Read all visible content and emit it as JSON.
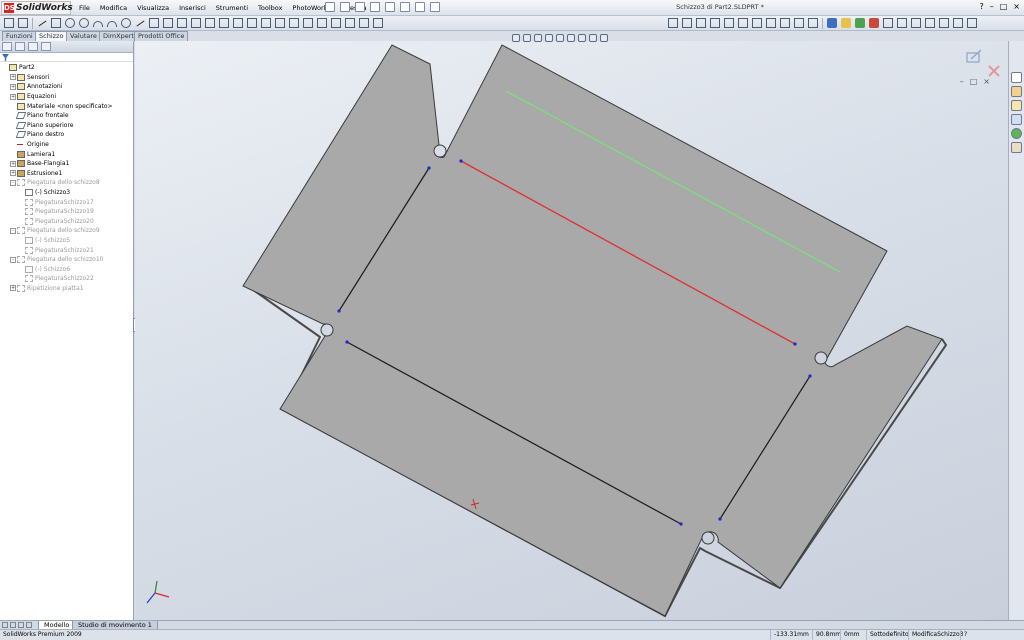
{
  "app": {
    "brand": "SolidWorks",
    "document_title": "Schizzo3 di Part2.SLDPRT *"
  },
  "menu": [
    "File",
    "Modifica",
    "Visualizza",
    "Inserisci",
    "Strumenti",
    "Toolbox",
    "PhotoWorks",
    "Finestra",
    "?"
  ],
  "command_tabs": [
    {
      "label": "Funzioni",
      "active": false
    },
    {
      "label": "Schizzo",
      "active": true
    },
    {
      "label": "Valutare",
      "active": false
    },
    {
      "label": "DimXpert",
      "active": false
    },
    {
      "label": "Prodotti Office",
      "active": false
    }
  ],
  "feature_tree": [
    {
      "label": "Part2",
      "indent": 0,
      "expander": "",
      "icon": "part-icon",
      "dim": false
    },
    {
      "label": "Sensori",
      "indent": 1,
      "expander": "+",
      "icon": "sensor-icon",
      "dim": false
    },
    {
      "label": "Annotazioni",
      "indent": 1,
      "expander": "+",
      "icon": "annotation-icon",
      "dim": false
    },
    {
      "label": "Equazioni",
      "indent": 1,
      "expander": "+",
      "icon": "equation-icon",
      "dim": false
    },
    {
      "label": "Materiale <non specificato>",
      "indent": 1,
      "expander": "",
      "icon": "material-icon",
      "dim": false
    },
    {
      "label": "Piano frontale",
      "indent": 1,
      "expander": "",
      "icon": "plane-icon",
      "dim": false
    },
    {
      "label": "Piano superiore",
      "indent": 1,
      "expander": "",
      "icon": "plane-icon",
      "dim": false
    },
    {
      "label": "Piano destro",
      "indent": 1,
      "expander": "",
      "icon": "plane-icon",
      "dim": false
    },
    {
      "label": "Origine",
      "indent": 1,
      "expander": "",
      "icon": "origin-icon",
      "dim": false
    },
    {
      "label": "Lamiera1",
      "indent": 1,
      "expander": "",
      "icon": "sheetmetal-icon",
      "dim": false
    },
    {
      "label": "Base-Flangia1",
      "indent": 1,
      "expander": "+",
      "icon": "flange-icon",
      "dim": false
    },
    {
      "label": "Estrusione1",
      "indent": 1,
      "expander": "+",
      "icon": "extrude-icon",
      "dim": false
    },
    {
      "label": "Piegatura dello schizzo8",
      "indent": 1,
      "expander": "-",
      "icon": "bend-icon",
      "dim": true
    },
    {
      "label": "(-) Schizzo3",
      "indent": 2,
      "expander": "",
      "icon": "sketch-icon",
      "dim": false
    },
    {
      "label": "PiegaturaSchizzo17",
      "indent": 2,
      "expander": "",
      "icon": "bend-icon",
      "dim": true
    },
    {
      "label": "PiegaturaSchizzo19",
      "indent": 2,
      "expander": "",
      "icon": "bend-icon",
      "dim": true
    },
    {
      "label": "PiegaturaSchizzo20",
      "indent": 2,
      "expander": "",
      "icon": "bend-icon",
      "dim": true
    },
    {
      "label": "Piegatura dello schizzo9",
      "indent": 1,
      "expander": "-",
      "icon": "bend-icon",
      "dim": true
    },
    {
      "label": "(-) Schizzo5",
      "indent": 2,
      "expander": "",
      "icon": "sketch-icon",
      "dim": true
    },
    {
      "label": "PiegaturaSchizzo21",
      "indent": 2,
      "expander": "",
      "icon": "bend-icon",
      "dim": true
    },
    {
      "label": "Piegatura dello schizzo10",
      "indent": 1,
      "expander": "-",
      "icon": "bend-icon",
      "dim": true
    },
    {
      "label": "(-) Schizzo6",
      "indent": 2,
      "expander": "",
      "icon": "sketch-icon",
      "dim": true
    },
    {
      "label": "PiegaturaSchizzo22",
      "indent": 2,
      "expander": "",
      "icon": "bend-icon",
      "dim": true
    },
    {
      "label": "Ripetizione piatta1",
      "indent": 1,
      "expander": "+",
      "icon": "flatpattern-icon",
      "dim": true
    }
  ],
  "bottom_tabs": [
    {
      "label": "Modello",
      "active": true
    },
    {
      "label": "Studio di movimento 1",
      "active": false
    }
  ],
  "status": {
    "product": "SolidWorks Premium 2009",
    "x": "-133.31mm",
    "y": "90.8mm",
    "z": "0mm",
    "state": "Sottodefinito",
    "mode": "ModificaSchizzo3"
  },
  "colors": {
    "part_face": "#a9a9a9",
    "part_edge": "#3a3a3a",
    "line_green": "#7ae07a",
    "line_red": "#e03030",
    "line_black": "#1a1a1a",
    "point_blue": "#1a2ad0"
  }
}
